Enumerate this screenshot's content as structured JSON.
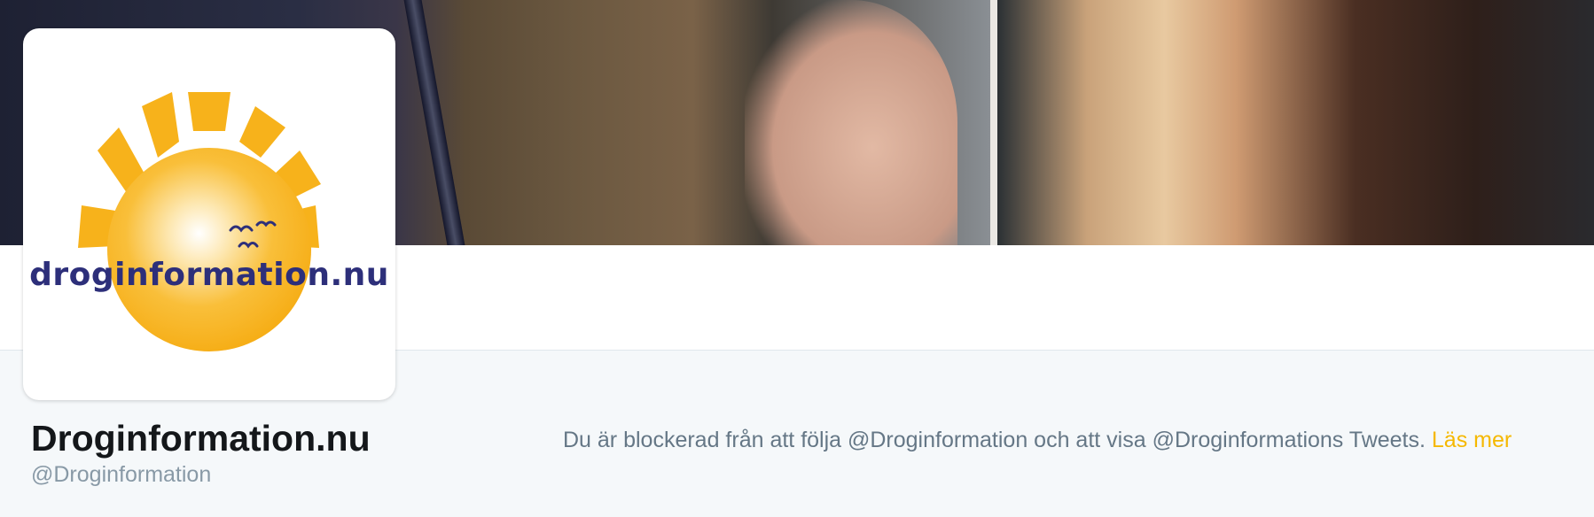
{
  "profile": {
    "logo_text": "droginformation.nu",
    "display_name": "Droginformation.nu",
    "handle": "@Droginformation"
  },
  "blocked_notice": {
    "message": "Du är blockerad från att följa @Droginformation och att visa @Droginformations Tweets.",
    "link_label": "Läs mer"
  },
  "colors": {
    "link": "#f5b800",
    "logo_sun": "#f7b21b",
    "logo_text": "#2d2f7a"
  }
}
